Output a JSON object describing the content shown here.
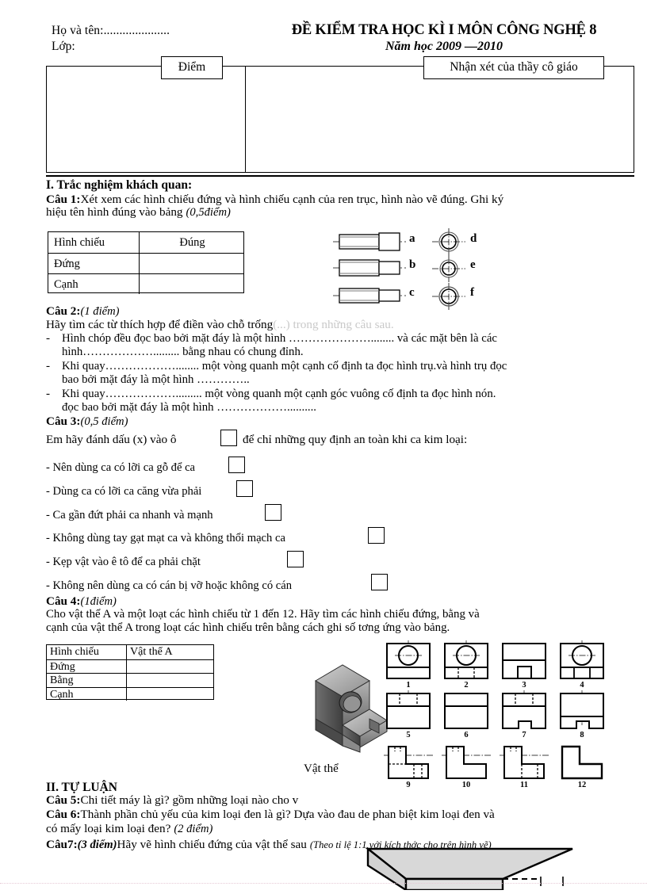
{
  "header": {
    "name_label": "Họ và tên:.....................",
    "class_label": "Lớp:",
    "title": "ĐỀ KIỂM TRA HỌC KÌ I MÔN CÔNG NGHỆ 8",
    "subtitle": "Năm học 2009 —2010"
  },
  "marks_table": {
    "score_label": "Điểm",
    "comment_label": "Nhận xét của thầy cô giáo"
  },
  "section1": {
    "heading": "I. Trắc nghiệm khách quan:",
    "q1": {
      "label": "Câu 1:",
      "text": "Xét xem các hình chiếu đứng và hình chiếu cạnh của ren trục, hình nào vẽ đúng. Ghi ký",
      "text2": "hiệu tên hình đúng vào bảng",
      "points": "(0,5điểm)",
      "table": {
        "headers": [
          "Hình chiếu",
          "Đúng"
        ],
        "rows": [
          [
            "Đứng",
            ""
          ],
          [
            "Cạnh",
            ""
          ]
        ]
      },
      "figure_labels": [
        "a",
        "b",
        "c",
        "d",
        "e",
        "f"
      ]
    },
    "q2": {
      "label": "Câu 2:",
      "points": "(1 điểm)",
      "intro": "Hãy tìm các từ thích hợp để điền vào chỗ trống",
      "intro_faded": "(...) trong những câu sau.",
      "items": [
        {
          "bullet": "-",
          "line1": "Hình chóp đều đọc  bao bởi mặt đáy là một hình …………………........ và các mặt bên là các",
          "line2": "hình………………......... bằng nhau có chung đỉnh."
        },
        {
          "bullet": "-",
          "line1": "Khi quay………………........ một vòng quanh một cạnh cố định ta đọc  hình trụ.và hình trụ đọc",
          "line2": "bao bởi mặt đáy là một hình ………….."
        },
        {
          "bullet": "-",
          "line1": "Khi quay………………......... một vòng quanh một cạnh góc vuông cố định ta đọc  hình nón.",
          "line2": "đọc  bao bởi mặt đáy là một hình ……………….........."
        }
      ]
    },
    "q3": {
      "label": "Câu 3:",
      "points": "(0,5 điểm)",
      "intro_a": "Em hãy đánh dấu (x) vào ô",
      "intro_b": "để chỉ những quy định an toàn khi ca   kim loại:",
      "options": [
        "- Nên dùng ca   có lỡi   ca   gỗ để ca",
        "- Dùng ca   có lỡi   ca   căng vừa phải",
        "- Ca   gần đứt phải ca   nhanh và mạnh",
        "- Không dùng tay gạt mạt ca   và không thổi mạch ca",
        "- Kẹp vật  vào ê tô để ca   phải chặt",
        "- Không nên dùng ca   có cán bị vỡ hoặc không có cán"
      ]
    },
    "q4": {
      "label": "Câu 4:",
      "points": "(1điểm)",
      "line1": " Cho vật thể A và một loạt các hình chiếu từ 1 đến 12. Hãy tìm các hình chiếu đứng, bằng và",
      "line2": "cạnh của vật thể A trong loạt các hình chiếu trên bằng cách ghi số tơng   ứng vào bảng.",
      "table": {
        "headers": [
          "Hình chiếu",
          "Vật thể A"
        ],
        "rows": [
          [
            "Đứng",
            ""
          ],
          [
            "Bằng",
            ""
          ],
          [
            "Cạnh",
            ""
          ]
        ]
      },
      "object_label": "Vật thể",
      "projection_numbers": [
        "1",
        "2",
        "3",
        "4",
        "5",
        "6",
        "7",
        "8",
        "9",
        "10",
        "11",
        "12"
      ]
    }
  },
  "section2": {
    "heading": "II. TỰ LUẬN",
    "q5": {
      "label": "Câu 5:",
      "text": "Chi tiết máy là gì? gồm những loại nào cho v"
    },
    "q6": {
      "label": "Câu 6:",
      "line1": "Thành phần chủ yếu của kim loại đen là gì? Dựa vào đau   de phan biệt kim loại đen và",
      "line2": "có mấy loại kim loại đen?",
      "points": "(2 điểm)"
    },
    "q7": {
      "label": "Câu7:",
      "points": "(3 điểm)",
      "text": "Hãy vẽ hình chiếu đứng của vật thể  sau",
      "note": "(Theo tỉ lệ 1:1 với kích thớc   cho trên hình vẽ)"
    }
  },
  "colors": {
    "ink": "#000000",
    "slab_fill": "#d8d8d8",
    "object_fill": "#9a9a9a"
  }
}
